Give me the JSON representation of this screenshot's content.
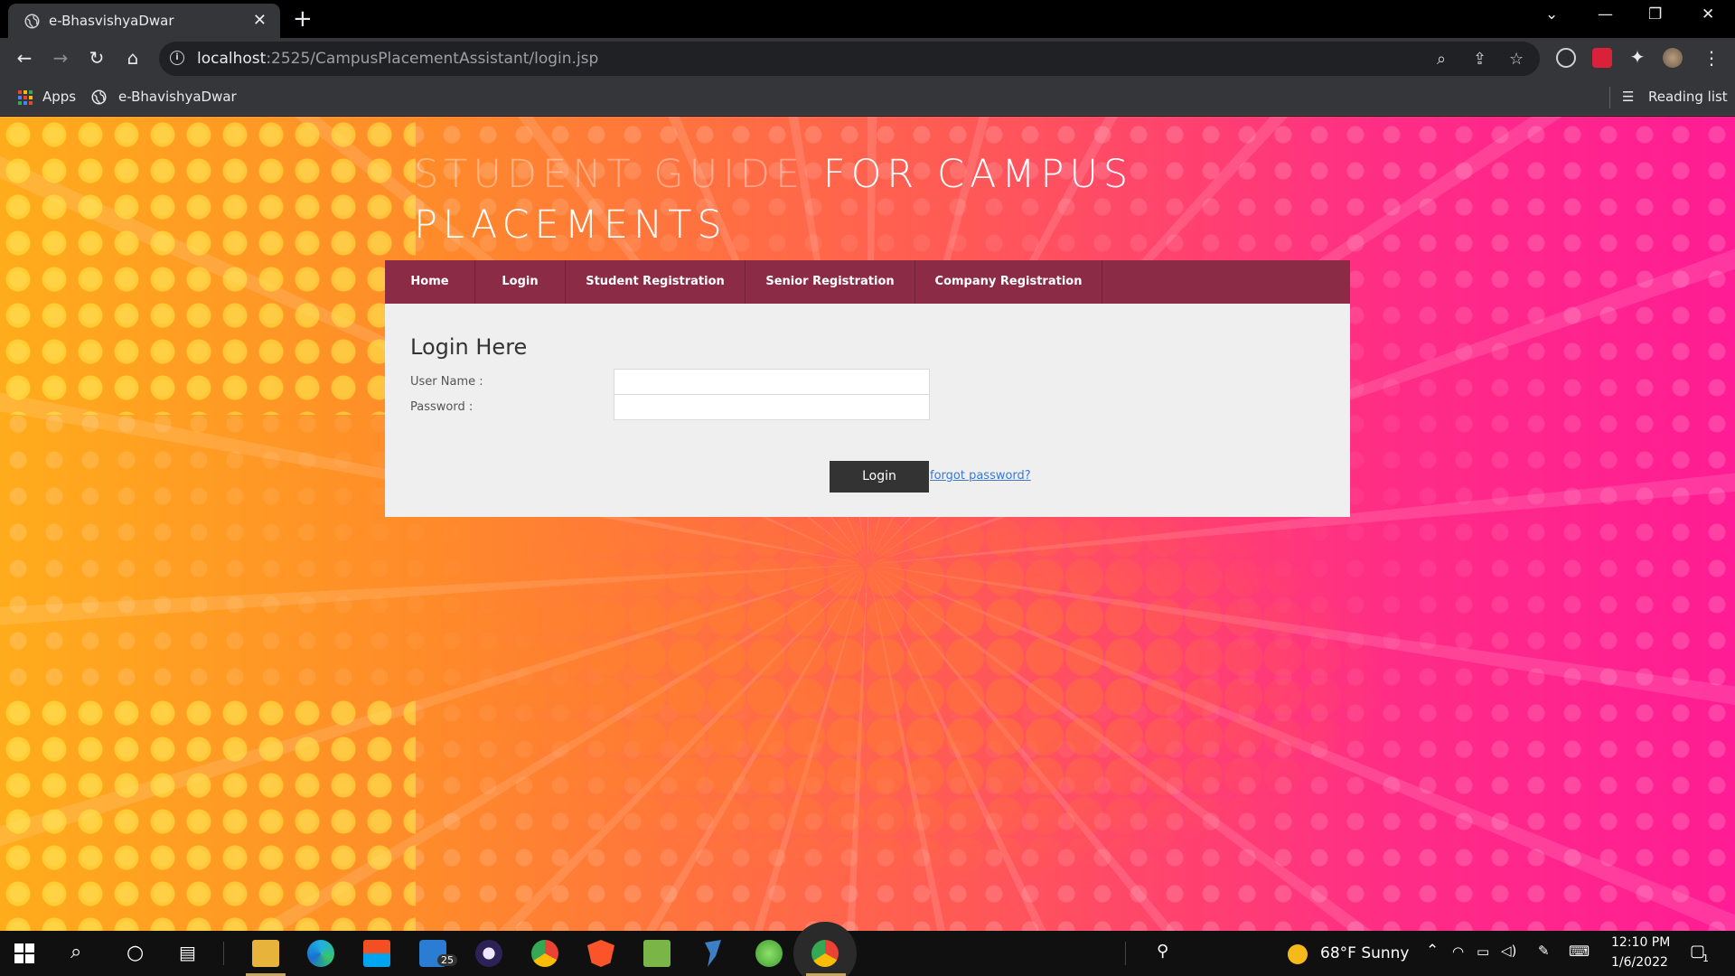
{
  "browser": {
    "tab_title": "e-BhasvishyaDwar",
    "url_host": "localhost",
    "url_rest": ":2525/CampusPlacementAssistant/login.jsp",
    "bookmarks": {
      "apps": "Apps",
      "site": "e-BhavishyaDwar",
      "reading_list": "Reading list"
    }
  },
  "page": {
    "title_part1": "STUDENT GUIDE",
    "title_part2": "FOR CAMPUS",
    "title_line2": "PLACEMENTS",
    "nav": [
      {
        "label": "Home"
      },
      {
        "label": "Login"
      },
      {
        "label": "Student Registration"
      },
      {
        "label": "Senior Registration"
      },
      {
        "label": "Company Registration"
      }
    ],
    "form": {
      "heading": "Login Here",
      "username_label": "User Name :",
      "password_label": "Password :",
      "username_value": "",
      "password_value": "",
      "login_label": "Login",
      "forgot_label": "forgot password?"
    }
  },
  "taskbar": {
    "weather": "68°F  Sunny",
    "time": "12:10 PM",
    "date": "1/6/2022",
    "mail_badge": "25",
    "notification_count": "1"
  },
  "colors": {
    "nav_bg": "#8b2b45",
    "panel_bg": "#efefef",
    "button_bg": "#333333",
    "link": "#3b78d8"
  }
}
